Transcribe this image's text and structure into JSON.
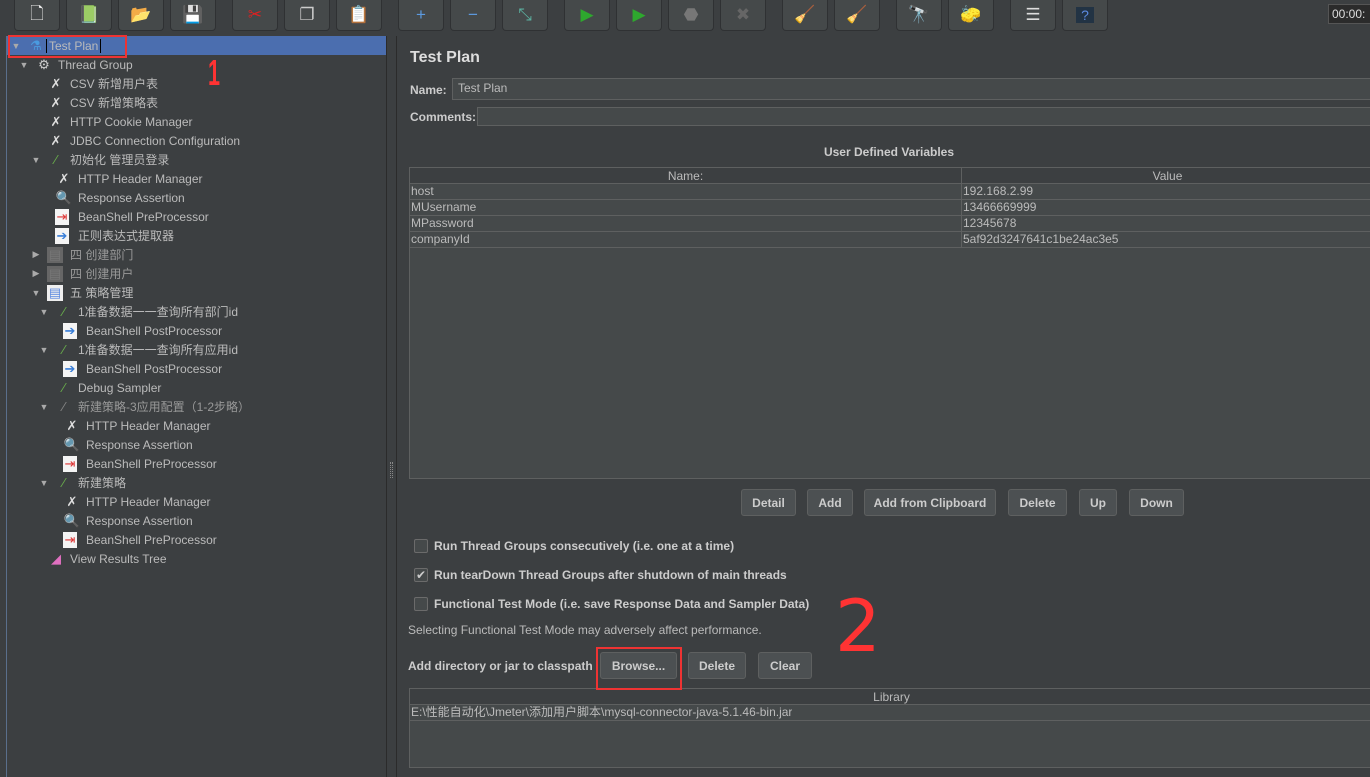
{
  "toolbar": {
    "buttons": [
      {
        "name": "new-icon",
        "glyph": "🗋"
      },
      {
        "name": "templates-icon",
        "glyph": "📗"
      },
      {
        "name": "open-icon",
        "glyph": "📂"
      },
      {
        "name": "save-icon",
        "glyph": "💾"
      },
      {
        "name": "cut-icon",
        "glyph": "✂"
      },
      {
        "name": "copy-icon",
        "glyph": "❐"
      },
      {
        "name": "paste-icon",
        "glyph": "📋"
      },
      {
        "name": "expand-icon",
        "glyph": "+"
      },
      {
        "name": "collapse-icon",
        "glyph": "−"
      },
      {
        "name": "toggle-icon",
        "glyph": "⤡"
      },
      {
        "name": "start-icon",
        "glyph": "▶"
      },
      {
        "name": "start-no-pauses-icon",
        "glyph": "▶"
      },
      {
        "name": "stop-icon",
        "glyph": "⬣"
      },
      {
        "name": "shutdown-icon",
        "glyph": "✖"
      },
      {
        "name": "clear-icon",
        "glyph": "🧹"
      },
      {
        "name": "clear-all-icon",
        "glyph": "🧹"
      },
      {
        "name": "search-icon",
        "glyph": "🔭"
      },
      {
        "name": "reset-search-icon",
        "glyph": "🧽"
      },
      {
        "name": "function-helper-icon",
        "glyph": "☰"
      },
      {
        "name": "help-icon",
        "glyph": "?"
      }
    ],
    "timer": "00:00:"
  },
  "tree": [
    {
      "label": "Test Plan",
      "level": 0,
      "arrow": "▼",
      "icon": "test-plan-icon",
      "glyph": "⚗",
      "selected": true
    },
    {
      "label": "Thread Group",
      "level": 1,
      "arrow": "▼",
      "icon": "thread-group-icon",
      "glyph": "⚙"
    },
    {
      "label": "CSV 新增用户表",
      "level": 2,
      "icon": "config-wrench-icon",
      "glyph": "✗"
    },
    {
      "label": "CSV 新增策略表",
      "level": 2,
      "icon": "config-wrench-icon",
      "glyph": "✗"
    },
    {
      "label": "HTTP Cookie Manager",
      "level": 2,
      "icon": "config-wrench-icon",
      "glyph": "✗"
    },
    {
      "label": "JDBC Connection Configuration",
      "level": 2,
      "icon": "config-wrench-icon",
      "glyph": "✗"
    },
    {
      "label": "初始化 管理员登录",
      "level": 2,
      "arrow": "▼",
      "icon": "sampler-pipette-icon",
      "glyph": "⁄"
    },
    {
      "label": "HTTP Header Manager",
      "level": 3,
      "icon": "config-wrench-icon",
      "glyph": "✗"
    },
    {
      "label": "Response Assertion",
      "level": 3,
      "icon": "assertion-magnifier-icon",
      "glyph": "🔍"
    },
    {
      "label": "BeanShell PreProcessor",
      "level": 3,
      "icon": "preprocessor-icon",
      "glyph": "⇥"
    },
    {
      "label": "正则表达式提取器",
      "level": 3,
      "icon": "postprocessor-icon",
      "glyph": "➔"
    },
    {
      "label": "四 创建部门",
      "level": 2,
      "arrow": "▶",
      "icon": "controller-disabled-icon",
      "glyph": "▤",
      "disabled": true
    },
    {
      "label": "四 创建用户",
      "level": 2,
      "arrow": "▶",
      "icon": "controller-disabled-icon",
      "glyph": "▤",
      "disabled": true
    },
    {
      "label": "五 策略管理",
      "level": 2,
      "arrow": "▼",
      "icon": "controller-icon",
      "glyph": "▤"
    },
    {
      "label": "1准备数据一一查询所有部门id",
      "level": 3,
      "arrow": "▼",
      "icon": "sampler-pipette-icon",
      "glyph": "⁄"
    },
    {
      "label": "BeanShell PostProcessor",
      "level": 4,
      "icon": "postprocessor-icon",
      "glyph": "➔"
    },
    {
      "label": "1准备数据一一查询所有应用id",
      "level": 3,
      "arrow": "▼",
      "icon": "sampler-pipette-icon",
      "glyph": "⁄"
    },
    {
      "label": "BeanShell PostProcessor",
      "level": 4,
      "icon": "postprocessor-icon",
      "glyph": "➔"
    },
    {
      "label": "Debug Sampler",
      "level": 3,
      "icon": "sampler-pipette-icon",
      "glyph": "⁄"
    },
    {
      "label": "新建策略-3应用配置（1-2步略）",
      "level": 3,
      "arrow": "▼",
      "icon": "sampler-disabled-icon",
      "glyph": "⁄",
      "disabled": true
    },
    {
      "label": "HTTP Header Manager",
      "level": 4,
      "icon": "config-wrench-icon",
      "glyph": "✗"
    },
    {
      "label": "Response Assertion",
      "level": 4,
      "icon": "assertion-magnifier-icon",
      "glyph": "🔍"
    },
    {
      "label": "BeanShell PreProcessor",
      "level": 4,
      "icon": "preprocessor-icon",
      "glyph": "⇥"
    },
    {
      "label": "新建策略",
      "level": 3,
      "arrow": "▼",
      "icon": "sampler-pipette-icon",
      "glyph": "⁄"
    },
    {
      "label": "HTTP Header Manager",
      "level": 4,
      "icon": "config-wrench-icon",
      "glyph": "✗"
    },
    {
      "label": "Response Assertion",
      "level": 4,
      "icon": "assertion-magnifier-icon",
      "glyph": "🔍"
    },
    {
      "label": "BeanShell PreProcessor",
      "level": 4,
      "icon": "preprocessor-icon",
      "glyph": "⇥"
    },
    {
      "label": "View Results Tree",
      "level": 2,
      "icon": "listener-chart-icon",
      "glyph": "◢"
    }
  ],
  "main": {
    "title": "Test Plan",
    "name_label": "Name:",
    "name_value": "Test Plan",
    "comments_label": "Comments:",
    "udv_title": "User Defined Variables",
    "udv_columns": [
      "Name:",
      "Value"
    ],
    "udv_rows": [
      [
        "host",
        "192.168.2.99"
      ],
      [
        "MUsername",
        "13466669999"
      ],
      [
        "MPassword",
        "12345678"
      ],
      [
        "companyId",
        "5af92d3247641c1be24ac3e5"
      ]
    ],
    "buttons": {
      "detail": "Detail",
      "add": "Add",
      "add_clipboard": "Add from Clipboard",
      "delete": "Delete",
      "up": "Up",
      "down": "Down"
    },
    "checkboxes": [
      {
        "label": "Run Thread Groups consecutively (i.e. one at a time)",
        "checked": false
      },
      {
        "label": "Run tearDown Thread Groups after shutdown of main threads",
        "checked": true
      },
      {
        "label": "Functional Test Mode (i.e. save Response Data and Sampler Data)",
        "checked": false
      }
    ],
    "functional_note": "Selecting Functional Test Mode may adversely affect performance.",
    "classpath_label": "Add directory or jar to classpath",
    "classpath_buttons": {
      "browse": "Browse...",
      "delete": "Delete",
      "clear": "Clear"
    },
    "library_header": "Library",
    "library_rows": [
      "E:\\性能自动化\\Jmeter\\添加用户脚本\\mysql-connector-java-5.1.46-bin.jar"
    ]
  },
  "annotations": {
    "one": "1",
    "two": "2"
  },
  "colors": {
    "selection": "#4b6eaf",
    "annotation": "#ee3333"
  }
}
